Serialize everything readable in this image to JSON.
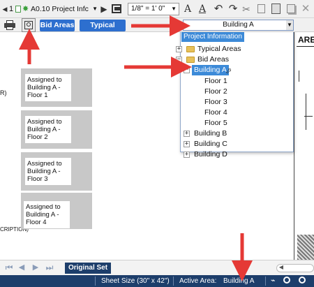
{
  "toolbar": {
    "page_number": "1",
    "sheet_name": "A0.10 Project Infc",
    "scale": "1/8\" = 1' 0\"",
    "bid_areas_label": "Bid Areas",
    "typical_areas_label": "Typical Areas",
    "active_area_select": "Building A"
  },
  "dropdown": {
    "header": "Project Information",
    "items": [
      {
        "label": "Typical Areas",
        "expand": "+"
      },
      {
        "label": "Bid Areas",
        "expand": "−"
      },
      {
        "label": "Building A",
        "expand": "−"
      },
      {
        "label": "Floor 1"
      },
      {
        "label": "Floor 2"
      },
      {
        "label": "Floor 3"
      },
      {
        "label": "Floor 4"
      },
      {
        "label": "Floor 5"
      },
      {
        "label": "Building B",
        "expand": "+"
      },
      {
        "label": "Building C",
        "expand": "+"
      },
      {
        "label": "Building D",
        "expand": "+"
      }
    ]
  },
  "canvas": {
    "tiles": [
      "Assigned to Building A - Floor 1",
      "Assigned to Building A - Floor 2",
      "Assigned to Building A - Floor 3",
      "Assigned to Building A - Floor 4"
    ],
    "left_fragment_1": "R)",
    "left_fragment_2": "CRIPTION)",
    "right_fragment": "ARE"
  },
  "navbar": {
    "original_set_label": "Original Set"
  },
  "status": {
    "sheet_size": "Sheet Size (30\" x 42\")",
    "active_area_label": "Active Area:",
    "active_area_value": "Building A"
  },
  "colors": {
    "blue_button": "#2d6fcf",
    "selected": "#3c8ad8",
    "status_bar": "#1d3e6b",
    "callout_arrow": "#e53935"
  },
  "icons": [
    "prev-page-icon",
    "sheet-icon",
    "play-icon",
    "copy-window-icon",
    "text-tool-icon",
    "text-style-icon",
    "undo-icon",
    "redo-icon",
    "scissors-icon",
    "clipboard-icon",
    "paste-icon",
    "stack-icon",
    "close-icon",
    "printer-icon",
    "zoom-window-icon"
  ]
}
